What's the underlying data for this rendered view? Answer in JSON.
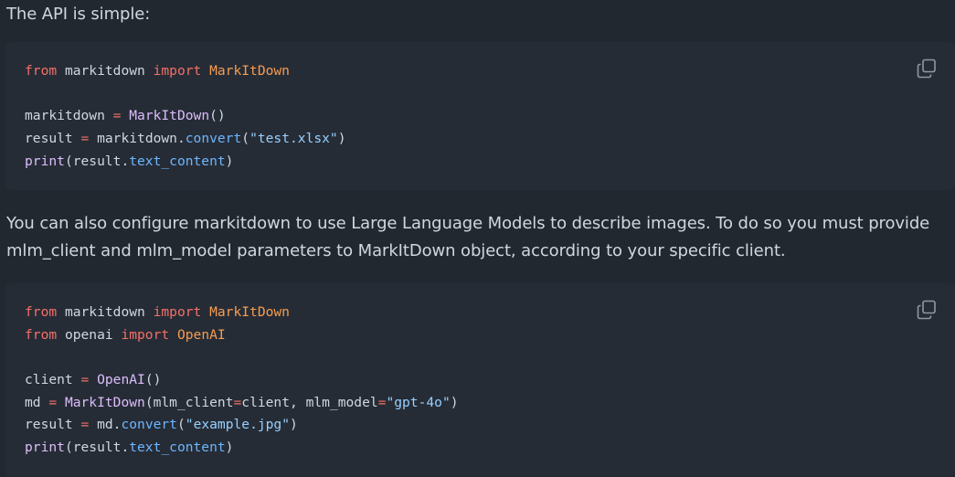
{
  "intro_text": "The API is simple:",
  "middle_text_line1": "You can also configure markitdown to use Large Language Models to describe images. To do so you must provide",
  "middle_text_line2": "mlm_client and mlm_model parameters to MarkItDown object, according to your specific client.",
  "code_block_1": {
    "copy_icon": "copy-icon",
    "lines": [
      [
        {
          "t": "kw",
          "v": "from"
        },
        {
          "t": "p",
          "v": " markitdown "
        },
        {
          "t": "kw",
          "v": "import"
        },
        {
          "t": "p",
          "v": " "
        },
        {
          "t": "cls",
          "v": "MarkItDown"
        }
      ],
      [],
      [
        {
          "t": "p",
          "v": "markitdown "
        },
        {
          "t": "op",
          "v": "="
        },
        {
          "t": "p",
          "v": " "
        },
        {
          "t": "fn",
          "v": "MarkItDown"
        },
        {
          "t": "p",
          "v": "()"
        }
      ],
      [
        {
          "t": "p",
          "v": "result "
        },
        {
          "t": "op",
          "v": "="
        },
        {
          "t": "p",
          "v": " markitdown."
        },
        {
          "t": "attr",
          "v": "convert"
        },
        {
          "t": "p",
          "v": "("
        },
        {
          "t": "str",
          "v": "\"test.xlsx\""
        },
        {
          "t": "p",
          "v": ")"
        }
      ],
      [
        {
          "t": "fn",
          "v": "print"
        },
        {
          "t": "p",
          "v": "(result."
        },
        {
          "t": "attr",
          "v": "text_content"
        },
        {
          "t": "p",
          "v": ")"
        }
      ]
    ]
  },
  "code_block_2": {
    "copy_icon": "copy-icon",
    "lines": [
      [
        {
          "t": "kw",
          "v": "from"
        },
        {
          "t": "p",
          "v": " markitdown "
        },
        {
          "t": "kw",
          "v": "import"
        },
        {
          "t": "p",
          "v": " "
        },
        {
          "t": "cls",
          "v": "MarkItDown"
        }
      ],
      [
        {
          "t": "kw",
          "v": "from"
        },
        {
          "t": "p",
          "v": " openai "
        },
        {
          "t": "kw",
          "v": "import"
        },
        {
          "t": "p",
          "v": " "
        },
        {
          "t": "cls",
          "v": "OpenAI"
        }
      ],
      [],
      [
        {
          "t": "p",
          "v": "client "
        },
        {
          "t": "op",
          "v": "="
        },
        {
          "t": "p",
          "v": " "
        },
        {
          "t": "fn",
          "v": "OpenAI"
        },
        {
          "t": "p",
          "v": "()"
        }
      ],
      [
        {
          "t": "p",
          "v": "md "
        },
        {
          "t": "op",
          "v": "="
        },
        {
          "t": "p",
          "v": " "
        },
        {
          "t": "fn",
          "v": "MarkItDown"
        },
        {
          "t": "p",
          "v": "(mlm_client"
        },
        {
          "t": "op",
          "v": "="
        },
        {
          "t": "p",
          "v": "client, mlm_model"
        },
        {
          "t": "op",
          "v": "="
        },
        {
          "t": "str",
          "v": "\"gpt-4o\""
        },
        {
          "t": "p",
          "v": ")"
        }
      ],
      [
        {
          "t": "p",
          "v": "result "
        },
        {
          "t": "op",
          "v": "="
        },
        {
          "t": "p",
          "v": " md."
        },
        {
          "t": "attr",
          "v": "convert"
        },
        {
          "t": "p",
          "v": "("
        },
        {
          "t": "str",
          "v": "\"example.jpg\""
        },
        {
          "t": "p",
          "v": ")"
        }
      ],
      [
        {
          "t": "fn",
          "v": "print"
        },
        {
          "t": "p",
          "v": "(result."
        },
        {
          "t": "attr",
          "v": "text_content"
        },
        {
          "t": "p",
          "v": ")"
        }
      ]
    ]
  }
}
